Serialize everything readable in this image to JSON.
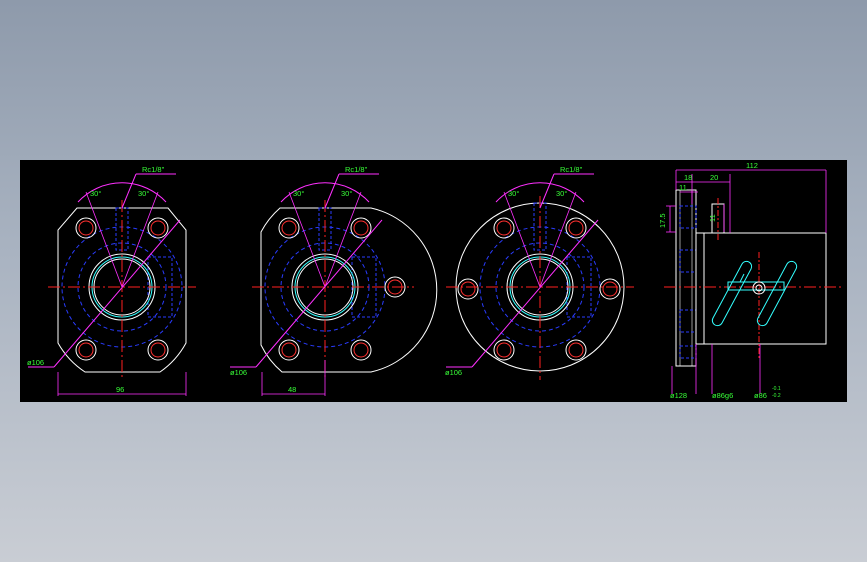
{
  "colors": {
    "background": "#000000",
    "outline": "#ffffff",
    "hidden_lines": "#2a3cff",
    "center_lines": "#ff2020",
    "dimensions": "#38ff38",
    "leaders": "#ff30ff",
    "cyan_detail": "#33ffff"
  },
  "views": [
    {
      "name": "flange-view-1",
      "angle_left": "30°",
      "angle_right": "30°",
      "hole_callout": "Rc1/8\"",
      "diameter_callout": "ø106",
      "width_dim": "96"
    },
    {
      "name": "flange-view-2",
      "angle_left": "30°",
      "angle_right": "30°",
      "hole_callout": "Rc1/8\"",
      "diameter_callout": "ø106",
      "width_dim": "48"
    },
    {
      "name": "flange-view-3",
      "angle_left": "30°",
      "angle_right": "30°",
      "hole_callout": "Rc1/8\"",
      "diameter_callout": "ø106"
    }
  ],
  "side_view": {
    "total_length": "112",
    "dim_18": "18",
    "dim_20": "20",
    "dim_11_top": "11",
    "dim_11_side": "11",
    "dim_17_5": "17.5",
    "dia_flange": "ø128",
    "dia_spigot": "ø86g6",
    "dia_body": "ø86",
    "tol_upper": "-0.1",
    "tol_lower": "-0.2"
  }
}
